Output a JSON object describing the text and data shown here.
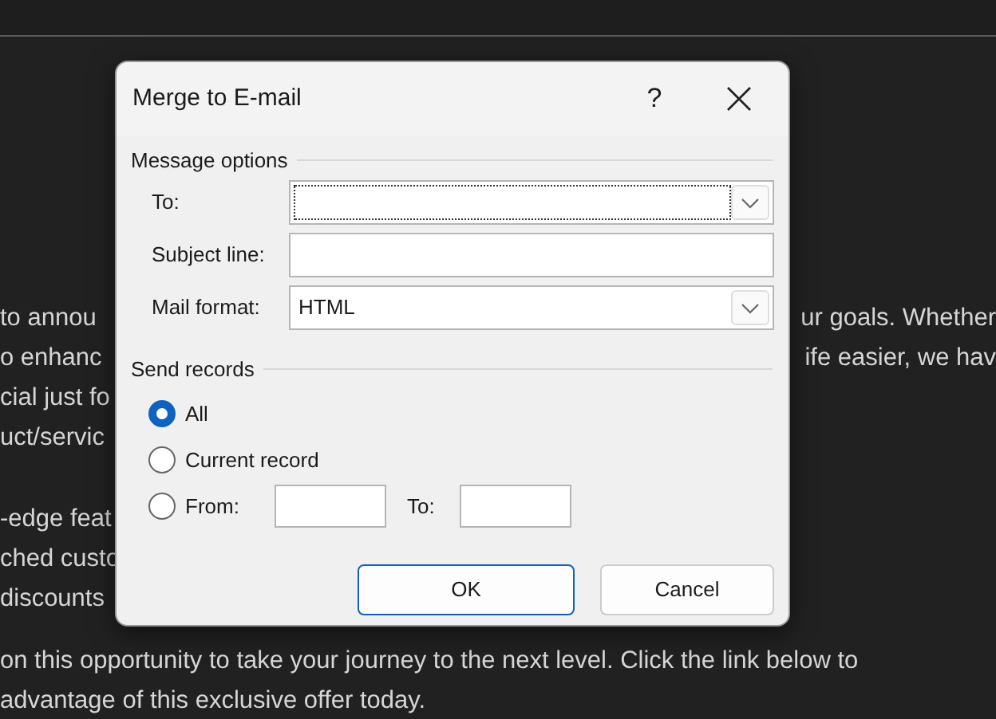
{
  "document": {
    "paragraphs": [
      {
        "lines": [
          {
            "left": "to annou",
            "right": "ur goals. Whether"
          },
          {
            "left": "o enhanc",
            "right": "ife easier, we hav"
          },
          {
            "left": "cial just fo"
          },
          {
            "left": "uct/servic"
          }
        ]
      },
      {
        "lines": [
          {
            "left": "-edge feat"
          },
          {
            "left": "ched custo"
          },
          {
            "left": "discounts"
          }
        ]
      },
      {
        "lines": [
          {
            "left": "on this opportunity to take your journey to the next level. Click the link below to"
          },
          {
            "left": "advantage of this exclusive offer today."
          }
        ]
      }
    ]
  },
  "dialog": {
    "title": "Merge to E-mail",
    "help": "?",
    "message_options": {
      "label": "Message options",
      "fields": [
        {
          "kind": "combo",
          "label": "To:",
          "focused": true
        },
        {
          "kind": "text",
          "label": "Subject line:",
          "focused": false
        },
        {
          "kind": "combo",
          "label": "Mail format:",
          "value": "HTML",
          "focused": false
        }
      ]
    },
    "send_records": {
      "label": "Send records",
      "options": [
        {
          "kind": "plain",
          "label": "All",
          "selected": true
        },
        {
          "kind": "plain",
          "label": "Current record",
          "selected": false
        },
        {
          "kind": "range",
          "label": "From:",
          "selected": false,
          "to_label": "To:"
        }
      ]
    },
    "buttons": [
      {
        "label": "OK",
        "default": true
      },
      {
        "label": "Cancel",
        "default": false
      }
    ]
  }
}
